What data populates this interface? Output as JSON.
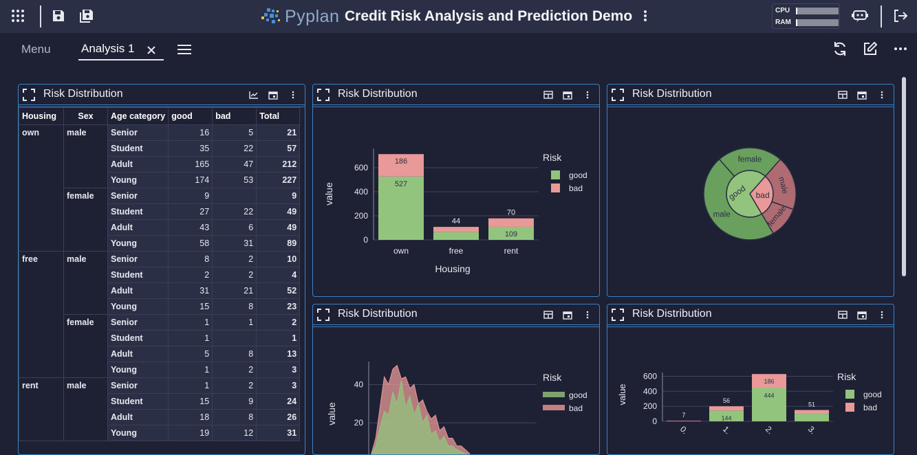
{
  "app": {
    "logo_text": "Pyplan",
    "title": "Credit Risk Analysis and Prediction Demo",
    "cpu_label": "CPU",
    "ram_label": "RAM",
    "cpu_usage": 0.03,
    "ram_usage": 0.03
  },
  "tabs": {
    "menu_label": "Menu",
    "active_label": "Analysis 1"
  },
  "cards": {
    "table_title": "Risk Distribution",
    "bar_title": "Risk Distribution",
    "sun_title": "Risk Distribution",
    "area_title": "Risk Distribution",
    "age_title": "Risk Distribution"
  },
  "table": {
    "headers": [
      "Housing",
      "Sex",
      "Age category",
      "good",
      "bad",
      "Total"
    ],
    "groups": [
      {
        "housing": "own",
        "sexes": [
          {
            "sex": "male",
            "rows": [
              [
                "Senior",
                "16",
                "5",
                "21"
              ],
              [
                "Student",
                "35",
                "22",
                "57"
              ],
              [
                "Adult",
                "165",
                "47",
                "212"
              ],
              [
                "Young",
                "174",
                "53",
                "227"
              ]
            ]
          },
          {
            "sex": "female",
            "rows": [
              [
                "Senior",
                "9",
                "",
                "9"
              ],
              [
                "Student",
                "27",
                "22",
                "49"
              ],
              [
                "Adult",
                "43",
                "6",
                "49"
              ],
              [
                "Young",
                "58",
                "31",
                "89"
              ]
            ]
          }
        ]
      },
      {
        "housing": "free",
        "sexes": [
          {
            "sex": "male",
            "rows": [
              [
                "Senior",
                "8",
                "2",
                "10"
              ],
              [
                "Student",
                "2",
                "2",
                "4"
              ],
              [
                "Adult",
                "31",
                "21",
                "52"
              ],
              [
                "Young",
                "15",
                "8",
                "23"
              ]
            ]
          },
          {
            "sex": "female",
            "rows": [
              [
                "Senior",
                "1",
                "1",
                "2"
              ],
              [
                "Student",
                "1",
                "",
                "1"
              ],
              [
                "Adult",
                "5",
                "8",
                "13"
              ],
              [
                "Young",
                "1",
                "2",
                "3"
              ]
            ]
          }
        ]
      },
      {
        "housing": "rent",
        "sexes": [
          {
            "sex": "male",
            "rows": [
              [
                "Senior",
                "1",
                "2",
                "3"
              ],
              [
                "Student",
                "15",
                "9",
                "24"
              ],
              [
                "Adult",
                "18",
                "8",
                "26"
              ],
              [
                "Young",
                "19",
                "12",
                "31"
              ]
            ]
          }
        ]
      }
    ]
  },
  "chart_data": [
    {
      "type": "bar",
      "stacked": true,
      "categories": [
        "own",
        "free",
        "rent"
      ],
      "series": [
        {
          "name": "good",
          "values": [
            527,
            64,
            109
          ],
          "color": "#93c47d"
        },
        {
          "name": "bad",
          "values": [
            186,
            44,
            70
          ],
          "color": "#ea9999"
        }
      ],
      "data_labels": {
        "good": [
          "527",
          "",
          "109"
        ],
        "bad": [
          "186",
          "44",
          "70"
        ]
      },
      "xlabel": "Housing",
      "ylabel": "value",
      "yticks": [
        0,
        200,
        400,
        600
      ],
      "ylim": [
        0,
        760
      ],
      "legend_title": "Risk",
      "legend_position": "right"
    },
    {
      "type": "pie",
      "subtype": "sunburst",
      "inner": [
        {
          "label": "good",
          "value": 700,
          "color": "#93c47d"
        },
        {
          "label": "bad",
          "value": 300,
          "color": "#ea9999"
        }
      ],
      "outer": [
        {
          "label": "male",
          "parent": "good",
          "value": 470,
          "color": "#6aa05e"
        },
        {
          "label": "female",
          "parent": "good",
          "value": 230,
          "color": "#6aa05e"
        },
        {
          "label": "male",
          "parent": "bad",
          "value": 190,
          "color": "#b06b72"
        },
        {
          "label": "female",
          "parent": "bad",
          "value": 110,
          "color": "#b06b72"
        }
      ]
    },
    {
      "type": "area",
      "ylabel": "value",
      "yticks": [
        20,
        40
      ],
      "ylim": [
        0,
        52
      ],
      "legend_title": "Risk",
      "legend_position": "right",
      "series": [
        {
          "name": "good",
          "color": "#93c47d",
          "values": [
            3,
            8,
            18,
            26,
            24,
            36,
            30,
            42,
            28,
            34,
            24,
            30,
            20,
            24,
            14,
            16,
            10,
            13,
            8,
            8,
            6,
            5,
            4,
            3
          ]
        },
        {
          "name": "bad",
          "color": "#ea9999",
          "values": [
            4,
            12,
            28,
            44,
            40,
            48,
            50,
            43,
            44,
            38,
            40,
            30,
            32,
            26,
            22,
            24,
            16,
            18,
            12,
            12,
            8,
            8,
            6,
            4
          ]
        }
      ]
    },
    {
      "type": "bar",
      "stacked": true,
      "categories": [
        "0.",
        "1.",
        "2.",
        "3."
      ],
      "series": [
        {
          "name": "good",
          "values": [
            0,
            144,
            444,
            100
          ],
          "color": "#93c47d"
        },
        {
          "name": "bad",
          "values": [
            7,
            56,
            186,
            51
          ],
          "color": "#ea9999"
        }
      ],
      "data_labels": {
        "good": [
          "",
          "144",
          "444",
          ""
        ],
        "bad": [
          "7",
          "56",
          "186",
          "51"
        ]
      },
      "ylabel": "value",
      "yticks": [
        0,
        200,
        400,
        600
      ],
      "ylim": [
        0,
        650
      ],
      "legend_title": "Risk",
      "legend_position": "right"
    }
  ]
}
